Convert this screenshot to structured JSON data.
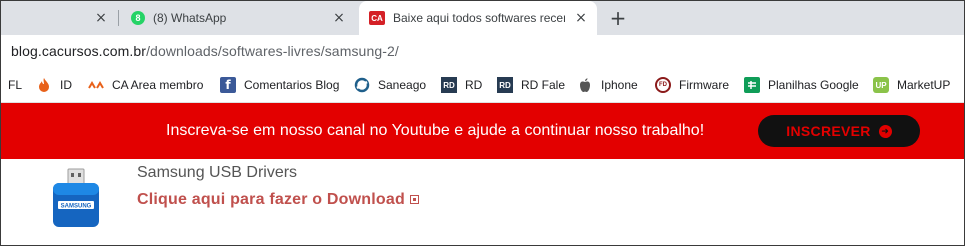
{
  "tabs": [
    {
      "title": "",
      "close": "×",
      "active": false
    },
    {
      "title": "(8) WhatsApp",
      "badge": "8",
      "close": "×",
      "active": false
    },
    {
      "title": "Baixe aqui todos softwares recen",
      "favicon": "CA",
      "close": "×",
      "active": true
    }
  ],
  "new_tab_label": "+",
  "address": {
    "host": "blog.cacursos.com.br",
    "path": "/downloads/softwares-livres/samsung-2/"
  },
  "bookmarks": [
    {
      "label": "FL",
      "icon": ""
    },
    {
      "label": "ID",
      "icon": "flame-icon"
    },
    {
      "label": "CA Area membro",
      "icon": "ca-wave-icon"
    },
    {
      "label": "Comentarios Blog",
      "icon": "facebook-icon"
    },
    {
      "label": "Saneago",
      "icon": "saneago-icon"
    },
    {
      "label": "RD",
      "icon": "rd-icon",
      "icon_text": "RD"
    },
    {
      "label": "RD Fale",
      "icon": "rd-icon",
      "icon_text": "RD"
    },
    {
      "label": "Iphone",
      "icon": "apple-icon"
    },
    {
      "label": "Firmware",
      "icon": "firmware-icon",
      "icon_text": "FD"
    },
    {
      "label": "Planilhas Google",
      "icon": "sheets-icon"
    },
    {
      "label": "MarketUP",
      "icon": "marketup-icon",
      "icon_text": "UP"
    }
  ],
  "banner": {
    "message": "Inscreva-se em nosso canal no Youtube e ajude a continuar nosso trabalho!",
    "button_label": "INSCREVER",
    "bg_color": "#e30000"
  },
  "content": {
    "icon_label": "SAMSUNG",
    "driver_name": "Samsung USB Drivers",
    "download_link": "Clique aqui para fazer o Download"
  }
}
